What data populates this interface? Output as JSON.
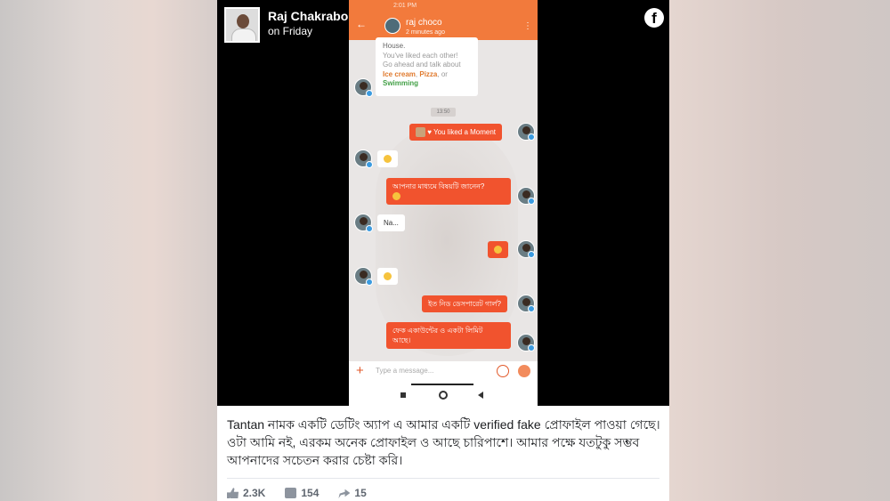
{
  "post": {
    "author": "Raj Chakraborty",
    "time": "on Friday",
    "caption": "Tantan নামক একটি ডেটিং অ্যাপ এ আমার একটি verified fake প্রোফাইল পাওয়া গেছে। ওটা আমি নই, এরকম অনেক প্রোফাইল ও আছে চারিপাশে। আমার পক্ষে যতটুকু সম্ভব আপনাদের সচেতন করার চেষ্টা করি।",
    "likes": "2.3K",
    "comments": "154",
    "shares": "15"
  },
  "phone": {
    "status_time": "2:01 PM",
    "chat_name": "raj choco",
    "chat_subtitle": "2 minutes ago",
    "match_card": {
      "line1": "House.",
      "line2": "You've liked each other!",
      "line3": "Go ahead and talk about",
      "topic1": "Ice cream",
      "sep1": ", ",
      "topic2": "Pizza",
      "sep2": ", or",
      "topic3": "Swimming"
    },
    "timestamp": "13:50",
    "messages": {
      "liked_moment": "You liked a Moment",
      "question": "আপনার মাধ্যমে বিষয়টি জানেন?",
      "na": "Na...",
      "desperate": "ইত নিড ডেসপারেট গার্ল?",
      "fake_line1": "ফেক একাউন্টের ও একটা লিমিট",
      "fake_line2": "আছে।"
    },
    "input_placeholder": "Type a message..."
  },
  "colors": {
    "accent": "#f27a3c",
    "bubble": "#f1532e"
  },
  "icons": [
    "facebook-icon",
    "verified-icon",
    "back-arrow-icon",
    "menu-dots-icon",
    "plus-icon",
    "emoji-icon",
    "send-icon",
    "like-icon",
    "comment-icon",
    "share-icon"
  ]
}
